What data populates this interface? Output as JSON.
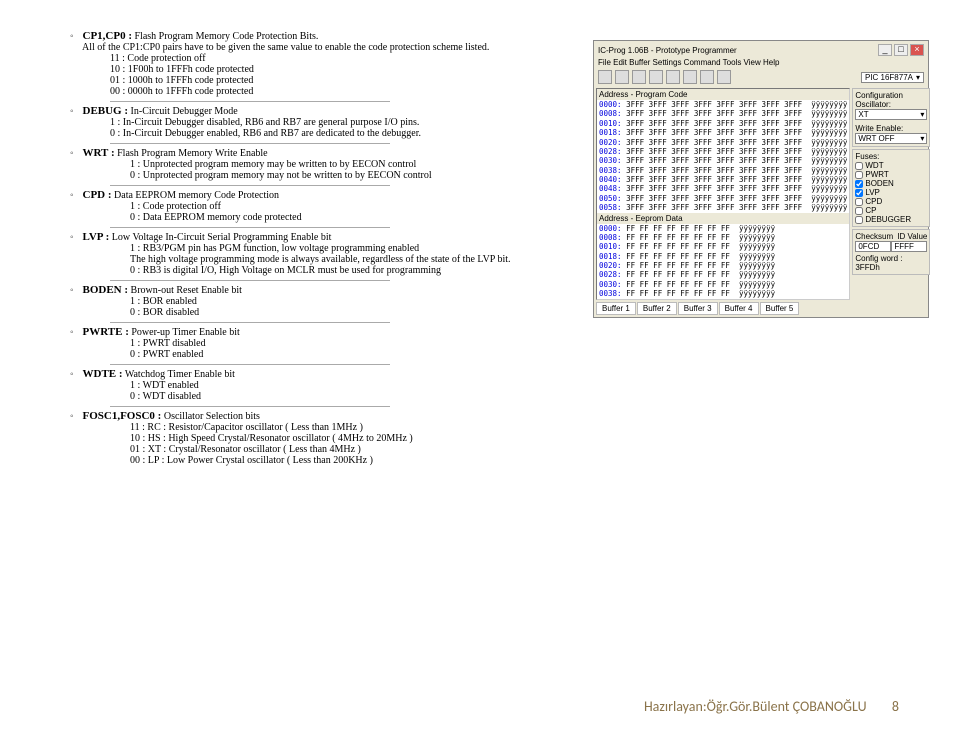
{
  "cp": {
    "label": "CP1,CP0 :",
    "desc": "Flash Program Memory Code Protection Bits.",
    "note": "All of the CP1:CP0 pairs have to be given the same value to enable the code protection scheme listed.",
    "v11": "11   :   Code protection off",
    "v10": "10   :   1F00h to 1FFFh code protected",
    "v01": "01   :   1000h to 1FFFh code protected",
    "v00": "00   :   0000h to 1FFFh code protected"
  },
  "debug": {
    "label": "DEBUG :",
    "desc": "In-Circuit Debugger Mode",
    "v1": "1   :   In-Circuit Debugger disabled, RB6 and RB7 are general purpose I/O pins.",
    "v0": "0   :   In-Circuit Debugger enabled, RB6 and RB7 are dedicated to the debugger."
  },
  "wrt": {
    "label": "WRT :",
    "desc": "Flash Program Memory Write Enable",
    "v1": "1   :   Unprotected program memory may be written to by EECON control",
    "v0": "0   :   Unprotected program memory may not be written to by EECON control"
  },
  "cpd": {
    "label": "CPD :",
    "desc": "Data EEPROM memory Code Protection",
    "v1": "1   :   Code protection off",
    "v0": "0   :   Data EEPROM memory code protected"
  },
  "lvp": {
    "label": "LVP :",
    "desc": "Low Voltage In-Circuit Serial Programming Enable bit",
    "v1a": "1   :   RB3/PGM pin has PGM function, low voltage programming enabled",
    "v1b": "         The high voltage programming mode is always available, regardless of the state of the LVP bit.",
    "v0": "0   :   RB3 is digital I/O, High Voltage on MCLR must be used for programming"
  },
  "boden": {
    "label": "BODEN :",
    "desc": "Brown-out Reset Enable bit",
    "v1": "1  :   BOR enabled",
    "v0": "0  :   BOR disabled"
  },
  "pwrte": {
    "label": "PWRTE :",
    "desc": "Power-up Timer Enable bit",
    "v1": "1  :   PWRT disabled",
    "v0": "0  :   PWRT enabled"
  },
  "wdte": {
    "label": "WDTE :",
    "desc": "Watchdog Timer Enable bit",
    "v1": "1  :   WDT enabled",
    "v0": "0  :   WDT disabled"
  },
  "fosc": {
    "label": "FOSC1,FOSC0 :",
    "desc": "Oscillator Selection bits",
    "v11": "11   :   RC : Resistor/Capacitor oscillator ( Less than 1MHz )",
    "v10": "10   :   HS : High Speed Crystal/Resonator oscillator ( 4MHz to 20MHz )",
    "v01": "01   :   XT : Crystal/Resonator oscillator ( Less than 4MHz )",
    "v00": "00   :   LP : Low Power Crystal oscillator ( Less than 200KHz )"
  },
  "screenshot": {
    "title": "IC-Prog 1.06B - Prototype Programmer",
    "menu": "File   Edit   Buffer   Settings   Command   Tools   View   Help",
    "chip": "PIC 16F877A",
    "section_prog": "Address - Program Code",
    "section_eeprom": "Address - Eeprom Data",
    "prog_rows": [
      {
        "a": "0000:",
        "h": "3FFF 3FFF 3FFF 3FFF 3FFF 3FFF 3FFF 3FFF",
        "c": "ÿÿÿÿÿÿÿÿ"
      },
      {
        "a": "0008:",
        "h": "3FFF 3FFF 3FFF 3FFF 3FFF 3FFF 3FFF 3FFF",
        "c": "ÿÿÿÿÿÿÿÿ"
      },
      {
        "a": "0010:",
        "h": "3FFF 3FFF 3FFF 3FFF 3FFF 3FFF 3FFF 3FFF",
        "c": "ÿÿÿÿÿÿÿÿ"
      },
      {
        "a": "0018:",
        "h": "3FFF 3FFF 3FFF 3FFF 3FFF 3FFF 3FFF 3FFF",
        "c": "ÿÿÿÿÿÿÿÿ"
      },
      {
        "a": "0020:",
        "h": "3FFF 3FFF 3FFF 3FFF 3FFF 3FFF 3FFF 3FFF",
        "c": "ÿÿÿÿÿÿÿÿ"
      },
      {
        "a": "0028:",
        "h": "3FFF 3FFF 3FFF 3FFF 3FFF 3FFF 3FFF 3FFF",
        "c": "ÿÿÿÿÿÿÿÿ"
      },
      {
        "a": "0030:",
        "h": "3FFF 3FFF 3FFF 3FFF 3FFF 3FFF 3FFF 3FFF",
        "c": "ÿÿÿÿÿÿÿÿ"
      },
      {
        "a": "0038:",
        "h": "3FFF 3FFF 3FFF 3FFF 3FFF 3FFF 3FFF 3FFF",
        "c": "ÿÿÿÿÿÿÿÿ"
      },
      {
        "a": "0040:",
        "h": "3FFF 3FFF 3FFF 3FFF 3FFF 3FFF 3FFF 3FFF",
        "c": "ÿÿÿÿÿÿÿÿ"
      },
      {
        "a": "0048:",
        "h": "3FFF 3FFF 3FFF 3FFF 3FFF 3FFF 3FFF 3FFF",
        "c": "ÿÿÿÿÿÿÿÿ"
      },
      {
        "a": "0050:",
        "h": "3FFF 3FFF 3FFF 3FFF 3FFF 3FFF 3FFF 3FFF",
        "c": "ÿÿÿÿÿÿÿÿ"
      },
      {
        "a": "0058:",
        "h": "3FFF 3FFF 3FFF 3FFF 3FFF 3FFF 3FFF 3FFF",
        "c": "ÿÿÿÿÿÿÿÿ"
      }
    ],
    "ee_rows": [
      {
        "a": "0000:",
        "h": "FF FF FF FF FF FF FF FF",
        "c": "ÿÿÿÿÿÿÿÿ"
      },
      {
        "a": "0008:",
        "h": "FF FF FF FF FF FF FF FF",
        "c": "ÿÿÿÿÿÿÿÿ"
      },
      {
        "a": "0010:",
        "h": "FF FF FF FF FF FF FF FF",
        "c": "ÿÿÿÿÿÿÿÿ"
      },
      {
        "a": "0018:",
        "h": "FF FF FF FF FF FF FF FF",
        "c": "ÿÿÿÿÿÿÿÿ"
      },
      {
        "a": "0020:",
        "h": "FF FF FF FF FF FF FF FF",
        "c": "ÿÿÿÿÿÿÿÿ"
      },
      {
        "a": "0028:",
        "h": "FF FF FF FF FF FF FF FF",
        "c": "ÿÿÿÿÿÿÿÿ"
      },
      {
        "a": "0030:",
        "h": "FF FF FF FF FF FF FF FF",
        "c": "ÿÿÿÿÿÿÿÿ"
      },
      {
        "a": "0038:",
        "h": "FF FF FF FF FF FF FF FF",
        "c": "ÿÿÿÿÿÿÿÿ"
      }
    ],
    "config": {
      "title": "Configuration",
      "osc_label": "Oscillator:",
      "osc_value": "XT",
      "we_label": "Write Enable:",
      "we_value": "WRT OFF",
      "fuses_label": "Fuses:",
      "fuses": [
        {
          "label": "WDT",
          "checked": false
        },
        {
          "label": "PWRT",
          "checked": false
        },
        {
          "label": "BODEN",
          "checked": true
        },
        {
          "label": "LVP",
          "checked": true
        },
        {
          "label": "CPD",
          "checked": false
        },
        {
          "label": "CP",
          "checked": false
        },
        {
          "label": "DEBUGGER",
          "checked": false
        }
      ],
      "cs_label": "Checksum",
      "cs_value": "0FCD",
      "idv_label": "ID Value",
      "idv_value": "FFFF",
      "cfg_word": "Config word : 3FFDh"
    },
    "tabs": [
      "Buffer 1",
      "Buffer 2",
      "Buffer 3",
      "Buffer 4",
      "Buffer 5"
    ]
  },
  "footer": {
    "author": "Hazırlayan:Öğr.Gör.Bülent ÇOBANOĞLU",
    "page": "8"
  }
}
